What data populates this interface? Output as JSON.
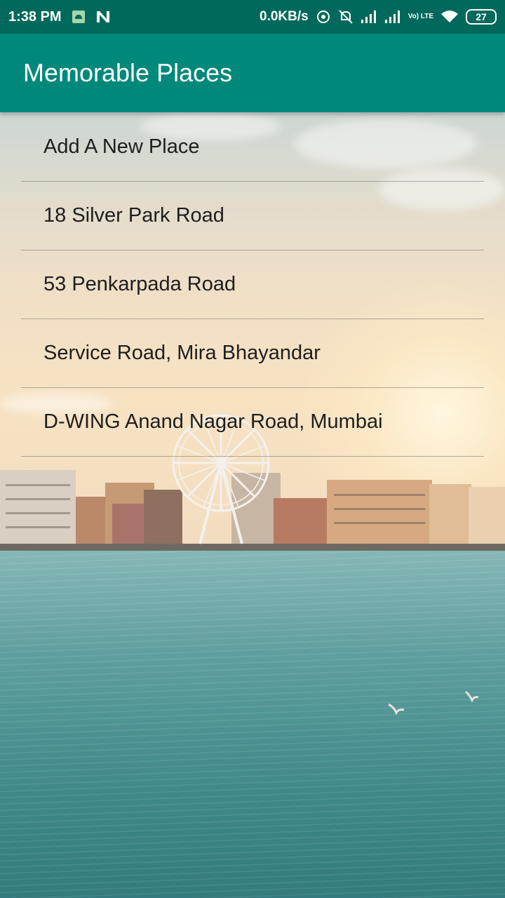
{
  "status_bar": {
    "time": "1:38 PM",
    "network_speed": "0.0KB/s",
    "volte_label": "Vo) LTE",
    "battery_level": "27",
    "icons": [
      "android-icon",
      "n-notification-icon",
      "hotspot-icon",
      "mute-icon",
      "signal-icon",
      "signal-icon",
      "volte-icon",
      "wifi-icon",
      "battery-icon"
    ]
  },
  "app_bar": {
    "title": "Memorable Places"
  },
  "places": [
    {
      "label": "Add A New Place"
    },
    {
      "label": "18 Silver Park Road"
    },
    {
      "label": "53 Penkarpada Road"
    },
    {
      "label": "Service Road, Mira Bhayandar"
    },
    {
      "label": "D-WING Anand Nagar Road, Mumbai"
    }
  ],
  "colors": {
    "status_bar": "#00695c",
    "app_bar": "#00897b",
    "list_text": "#1e1e1e"
  }
}
